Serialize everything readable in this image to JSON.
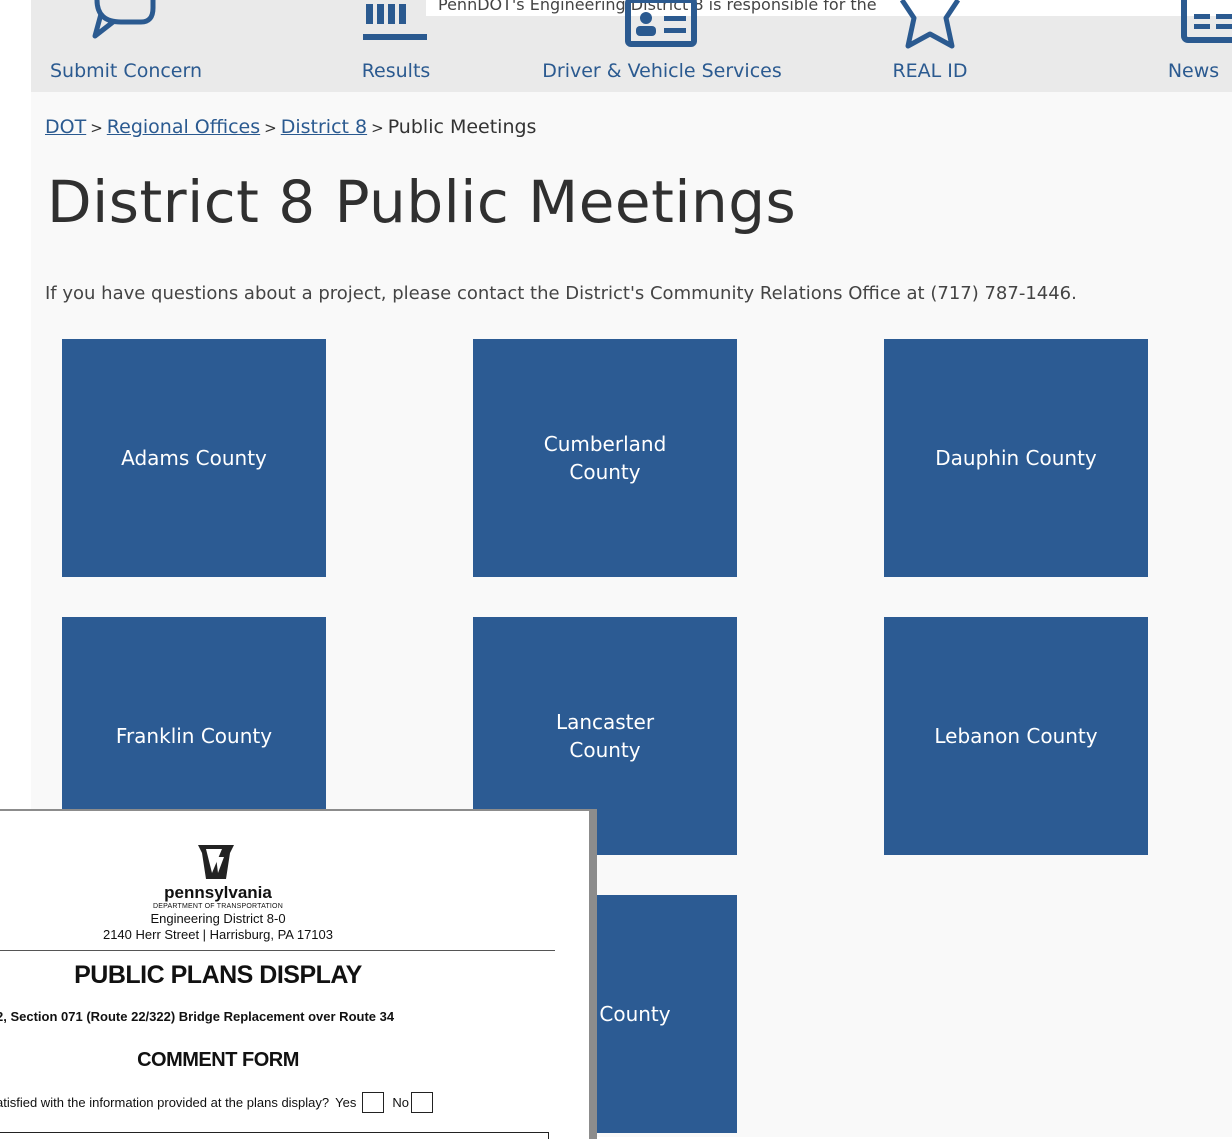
{
  "navbar": {
    "tooltip_text": "PennDOT's Engineering District 8 is responsible for the",
    "items": [
      {
        "label": "Submit Concern",
        "icon": "speech-bubble-icon"
      },
      {
        "label": "Results",
        "icon": "bar-chart-icon"
      },
      {
        "label": "Driver & Vehicle Services",
        "icon": "id-card-icon"
      },
      {
        "label": "REAL ID",
        "icon": "star-icon"
      },
      {
        "label": "News",
        "icon": "newspaper-icon"
      }
    ]
  },
  "breadcrumb": {
    "items": [
      "DOT",
      "Regional Offices",
      "District 8"
    ],
    "current": "Public Meetings",
    "separator": ">"
  },
  "page": {
    "title": "District 8 Public Meetings",
    "intro": "If you have questions about a project, please contact the District's Community Relations Office at (717) 787-1446."
  },
  "counties": [
    "Adams County",
    "Cumberland County",
    "Dauphin County",
    "Franklin County",
    "Lancaster County",
    "Lebanon County",
    "County"
  ],
  "form": {
    "wordmark": "pennsylvania",
    "department": "DEPARTMENT OF TRANSPORTATION",
    "district": "Engineering District 8-0",
    "address": "2140 Herr Street | Harrisburg, PA 17103",
    "heading": "PUBLIC PLANS DISPLAY",
    "project": "2, Section 071 (Route 22/322) Bridge Replacement over Route 34",
    "subheading": "COMMENT FORM",
    "question": "atisfied with the information provided at the plans display?",
    "yes_label": "Yes",
    "no_label": "No"
  },
  "colors": {
    "tile_blue": "#2c5b93",
    "link_blue": "#2b5a90",
    "navbar_bg": "#eaeaea",
    "page_bg": "#f9f9f9"
  }
}
